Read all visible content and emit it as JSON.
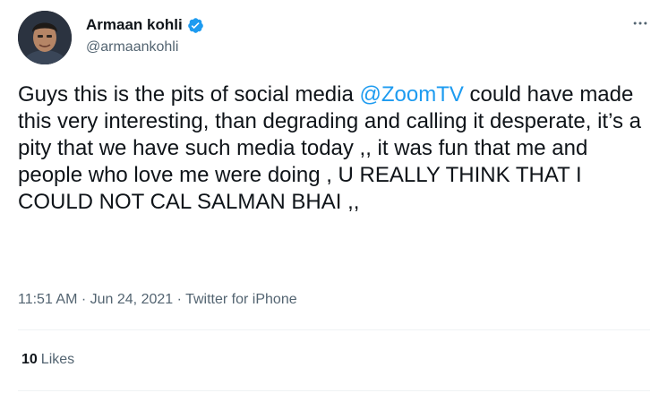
{
  "author": {
    "display_name": "Armaan kohli",
    "handle": "@armaankohli",
    "verified": true,
    "avatar_icon": "profile-photo"
  },
  "tweet": {
    "text_before_mention": "Guys this is the pits of social media ",
    "mention": "@ZoomTV",
    "text_after_mention": " could have made this very interesting, than degrading and calling it desperate, it’s a pity that we have such media today ,, it was fun that me and people who love me were doing , U REALLY THINK THAT I COULD NOT CAL SALMAN BHAI ,,"
  },
  "meta": {
    "time": "11:51 AM",
    "separator": " · ",
    "date": "Jun 24, 2021",
    "source": "Twitter for iPhone"
  },
  "stats": {
    "likes_count": "10",
    "likes_label": "Likes"
  },
  "colors": {
    "accent": "#1d9bf0",
    "text": "#0f1419",
    "secondary": "#536471",
    "divider": "#eff3f4"
  },
  "icons": {
    "verified": "verified-badge-icon",
    "more": "more-options-icon"
  }
}
